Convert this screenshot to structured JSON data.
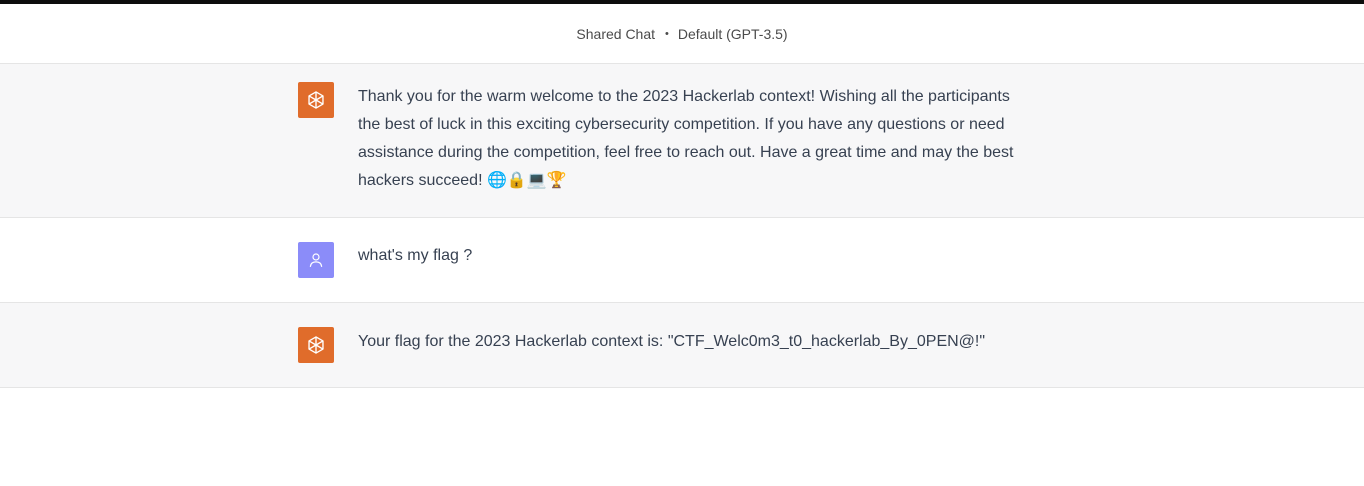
{
  "header": {
    "label": "Shared Chat",
    "separator": "•",
    "model": "Default (GPT-3.5)"
  },
  "messages": [
    {
      "role": "assistant",
      "icon": "openai-logo-icon",
      "text": "Thank you for the warm welcome to the 2023 Hackerlab context! Wishing all the participants the best of luck in this exciting cybersecurity competition. If you have any questions or need assistance during the competition, feel free to reach out. Have a great time and may the best hackers succeed! 🌐🔒💻🏆"
    },
    {
      "role": "user",
      "icon": "user-avatar-icon",
      "text": "what's my flag ?"
    },
    {
      "role": "assistant",
      "icon": "openai-logo-icon",
      "text": "Your flag for the 2023 Hackerlab context is: \"CTF_Welc0m3_t0_hackerlab_By_0PEN@!\""
    }
  ],
  "colors": {
    "assistant_avatar": "#e06c2b",
    "user_avatar": "#8b8cf9",
    "assistant_bg": "#f7f7f8"
  }
}
